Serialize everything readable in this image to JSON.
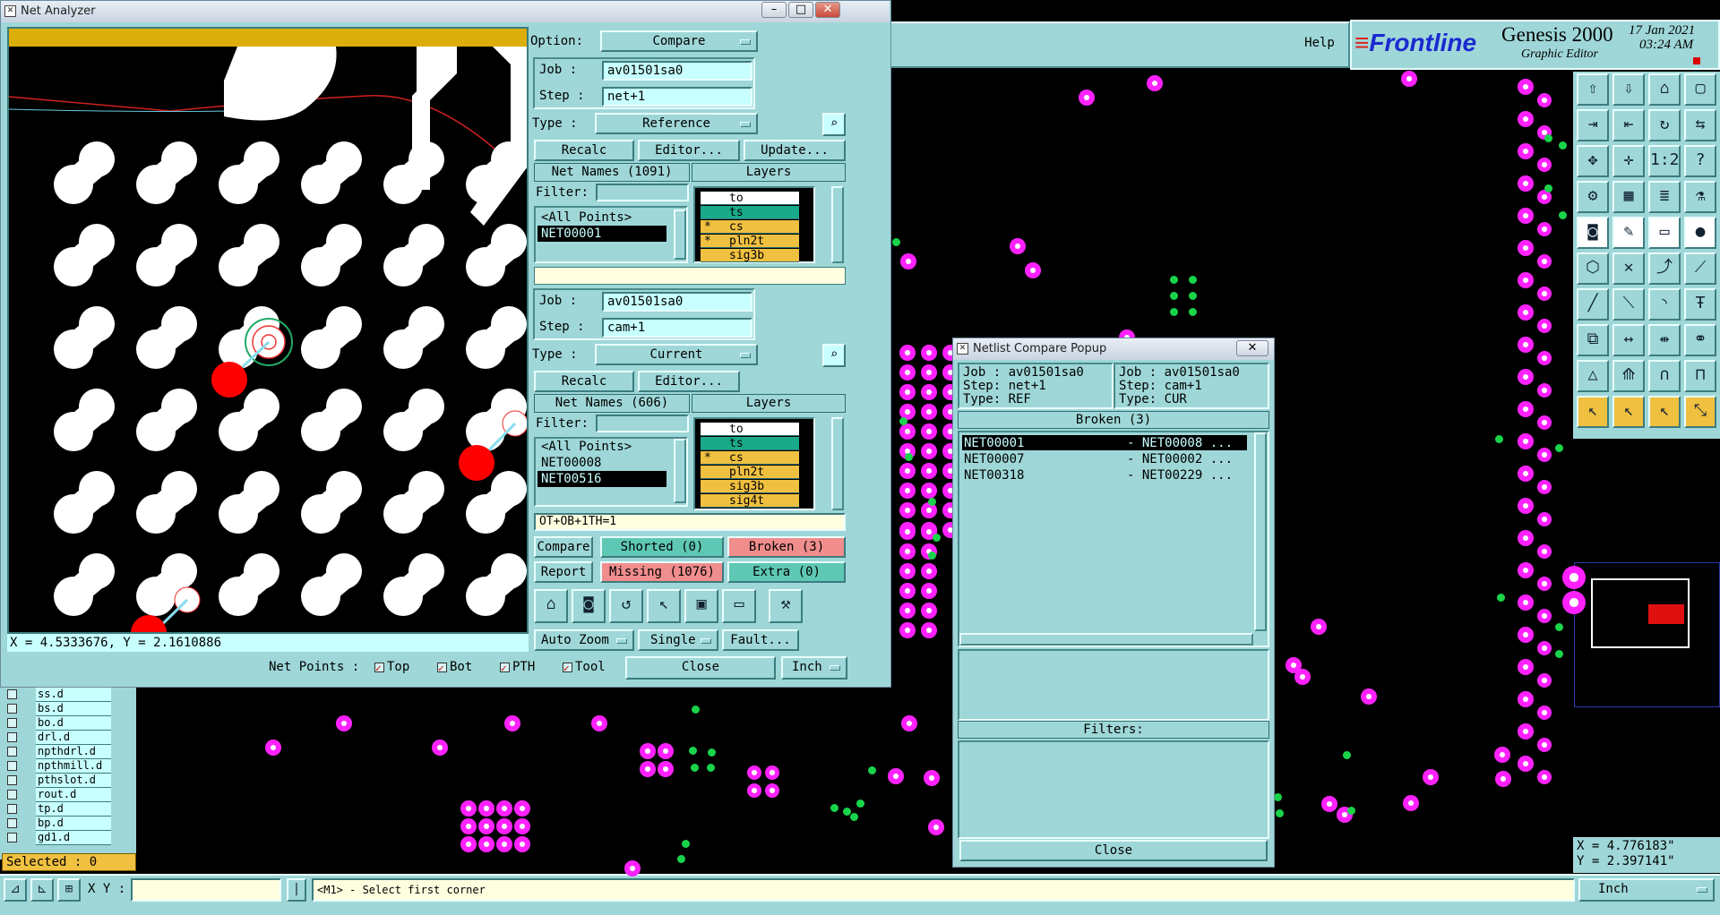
{
  "net_analyzer": {
    "title": "Net Analyzer",
    "coords": "X = 4.5333676, Y = 2.1610886",
    "option_label": "Option:",
    "option_value": "Compare",
    "ref": {
      "job_label": "Job  :",
      "job": "av01501sa0",
      "step_label": "Step :",
      "step": "net+1",
      "type_label": "Type :",
      "type": "Reference",
      "recalc": "Recalc",
      "editor": "Editor...",
      "update": "Update...",
      "net_names": "Net Names (1091)",
      "layers": "Layers",
      "filter_label": "Filter:",
      "nets": [
        "<All Points>",
        "NET00001"
      ],
      "layer_list": [
        {
          "mark": "",
          "name": "to"
        },
        {
          "mark": "",
          "name": "ts"
        },
        {
          "mark": "*",
          "name": "cs"
        },
        {
          "mark": "*",
          "name": "pln2t"
        },
        {
          "mark": "",
          "name": "sig3b"
        }
      ]
    },
    "cur": {
      "job_label": "Job  :",
      "job": "av01501sa0",
      "step_label": "Step :",
      "step": "cam+1",
      "type_label": "Type :",
      "type": "Current",
      "recalc": "Recalc",
      "editor": "Editor...",
      "net_names": "Net Names (606)",
      "layers": "Layers",
      "filter_label": "Filter:",
      "nets": [
        "<All Points>",
        "NET00008",
        "NET00516"
      ],
      "layer_list": [
        {
          "mark": "",
          "name": "to"
        },
        {
          "mark": "",
          "name": "ts"
        },
        {
          "mark": "*",
          "name": "cs"
        },
        {
          "mark": "",
          "name": "pln2t"
        },
        {
          "mark": "",
          "name": "sig3b"
        },
        {
          "mark": "",
          "name": "sig4t"
        }
      ]
    },
    "status": "OT+OB+1TH=1",
    "compare": "Compare",
    "shorted": "Shorted (0)",
    "broken": "Broken (3)",
    "report": "Report",
    "missing": "Missing (1076)",
    "extra": "Extra (0)",
    "auto_zoom": "Auto Zoom",
    "single": "Single",
    "fault": "Fault...",
    "net_points_label": "Net Points :",
    "np_top": "Top",
    "np_bot": "Bot",
    "np_pth": "PTH",
    "np_tool": "Tool",
    "close": "Close",
    "units": "Inch"
  },
  "popup": {
    "title": "Netlist Compare Popup",
    "left_job": "Job : av01501sa0",
    "left_step": "Step: net+1",
    "left_type": "Type: REF",
    "right_job": "Job : av01501sa0",
    "right_step": "Step: cam+1",
    "right_type": "Type: CUR",
    "broken_header": "Broken (3)",
    "rows": [
      {
        "a": "NET00001",
        "b": "- NET00008 ..."
      },
      {
        "a": "NET00007",
        "b": "- NET00002 ..."
      },
      {
        "a": "NET00318",
        "b": "- NET00229 ..."
      }
    ],
    "filters": "Filters:",
    "close": "Close"
  },
  "genesis": {
    "help": "Help",
    "brand": "Frontline",
    "product": "Genesis 2000",
    "subtitle": "Graphic Editor",
    "date": "17 Jan 2021",
    "time": "03:24 AM",
    "partial_date": "2021",
    "partial_ampm": "AM",
    "coord_x": "X =  4.776183\"",
    "coord_y": "Y =  2.397141\""
  },
  "layers_panel": {
    "items": [
      "ss.d",
      "bs.d",
      "bo.d",
      "drl.d",
      "npthdrl.d",
      "npthmill.d",
      "pthslot.d",
      "rout.d",
      "tp.d",
      "bp.d",
      "gd1.d"
    ],
    "selected": "Selected : 0"
  },
  "bottom": {
    "xy_label": "X Y :",
    "prompt": "<M1> - Select first corner",
    "units": "Inch"
  },
  "colors": {
    "panel": "#9fd7d8",
    "pad": "#ff22ff",
    "via": "#19d44a",
    "header_gold": "#dcae0a",
    "danger": "#f08d8d",
    "ok": "#5ec8b4"
  }
}
